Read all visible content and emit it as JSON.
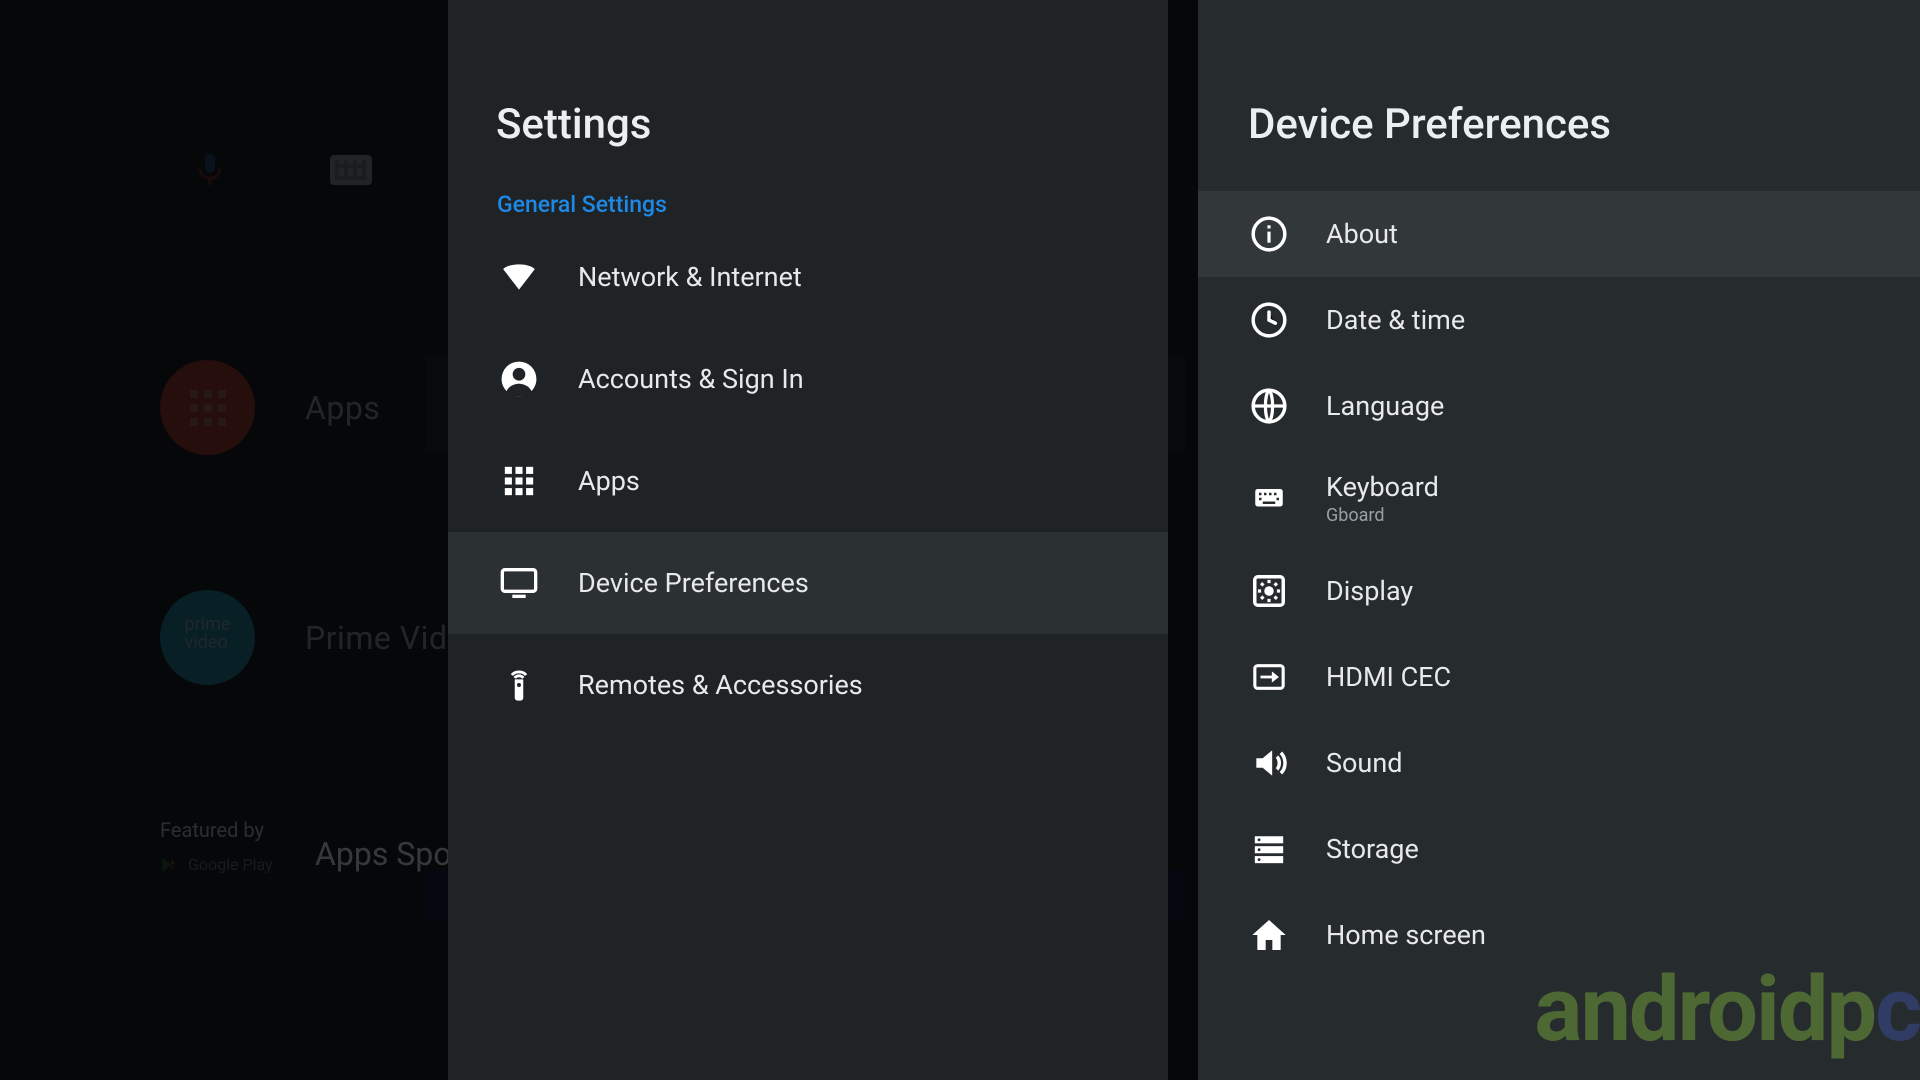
{
  "home": {
    "row_apps_label": "Apps",
    "row_prime_label": "Prime Video",
    "featured_by": "Featured by",
    "play_label": "Google Play",
    "spotlight_label": "Apps Spotlight"
  },
  "settings": {
    "title": "Settings",
    "group_label": "General Settings",
    "items": [
      {
        "label": "Network & Internet"
      },
      {
        "label": "Accounts & Sign In"
      },
      {
        "label": "Apps"
      },
      {
        "label": "Device Preferences"
      },
      {
        "label": "Remotes & Accessories"
      }
    ],
    "selected_index": 3
  },
  "prefs": {
    "title": "Device Preferences",
    "focused_index": 0,
    "items": [
      {
        "label": "About"
      },
      {
        "label": "Date & time"
      },
      {
        "label": "Language"
      },
      {
        "label": "Keyboard",
        "sub": "Gboard"
      },
      {
        "label": "Display"
      },
      {
        "label": "HDMI CEC"
      },
      {
        "label": "Sound"
      },
      {
        "label": "Storage"
      },
      {
        "label": "Home screen"
      }
    ]
  },
  "watermark": {
    "a": "androidp",
    "b": "c"
  }
}
